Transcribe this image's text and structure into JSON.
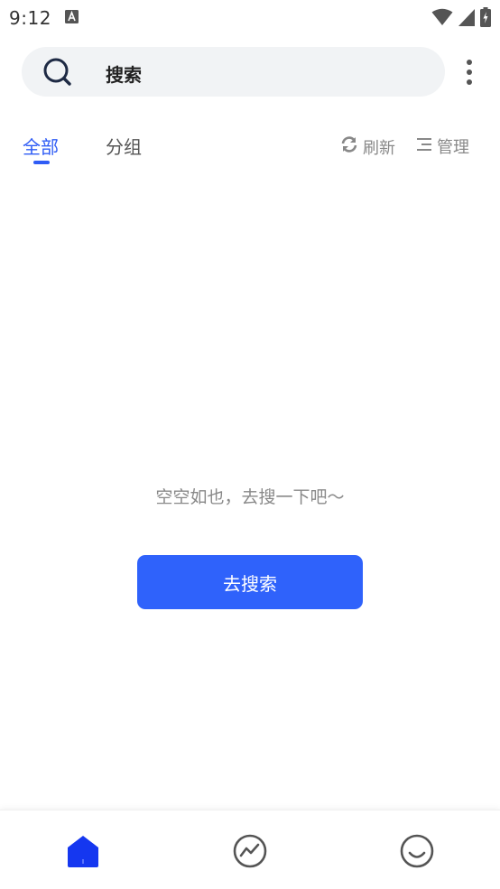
{
  "status_bar": {
    "time": "9:12",
    "icons": [
      "accessibility-notification-icon",
      "wifi-icon",
      "signal-icon",
      "battery-charging-icon"
    ]
  },
  "search": {
    "label": "搜索",
    "icon": "search-icon"
  },
  "menu": {
    "icon": "more-vertical-icon"
  },
  "tabs": [
    {
      "label": "全部",
      "active": true
    },
    {
      "label": "分组",
      "active": false
    }
  ],
  "actions": {
    "refresh_label": "刷新",
    "manage_label": "管理"
  },
  "empty_state": {
    "message": "空空如也，去搜一下吧～",
    "button_label": "去搜索"
  },
  "bottom_nav": {
    "items": [
      {
        "icon": "home-icon",
        "active": true
      },
      {
        "icon": "trend-icon",
        "active": false
      },
      {
        "icon": "smiley-icon",
        "active": false
      }
    ]
  },
  "colors": {
    "accent": "#2f5cf5",
    "button": "#2f62fb",
    "search_bg": "#f1f3f5",
    "muted_text": "#888888"
  }
}
